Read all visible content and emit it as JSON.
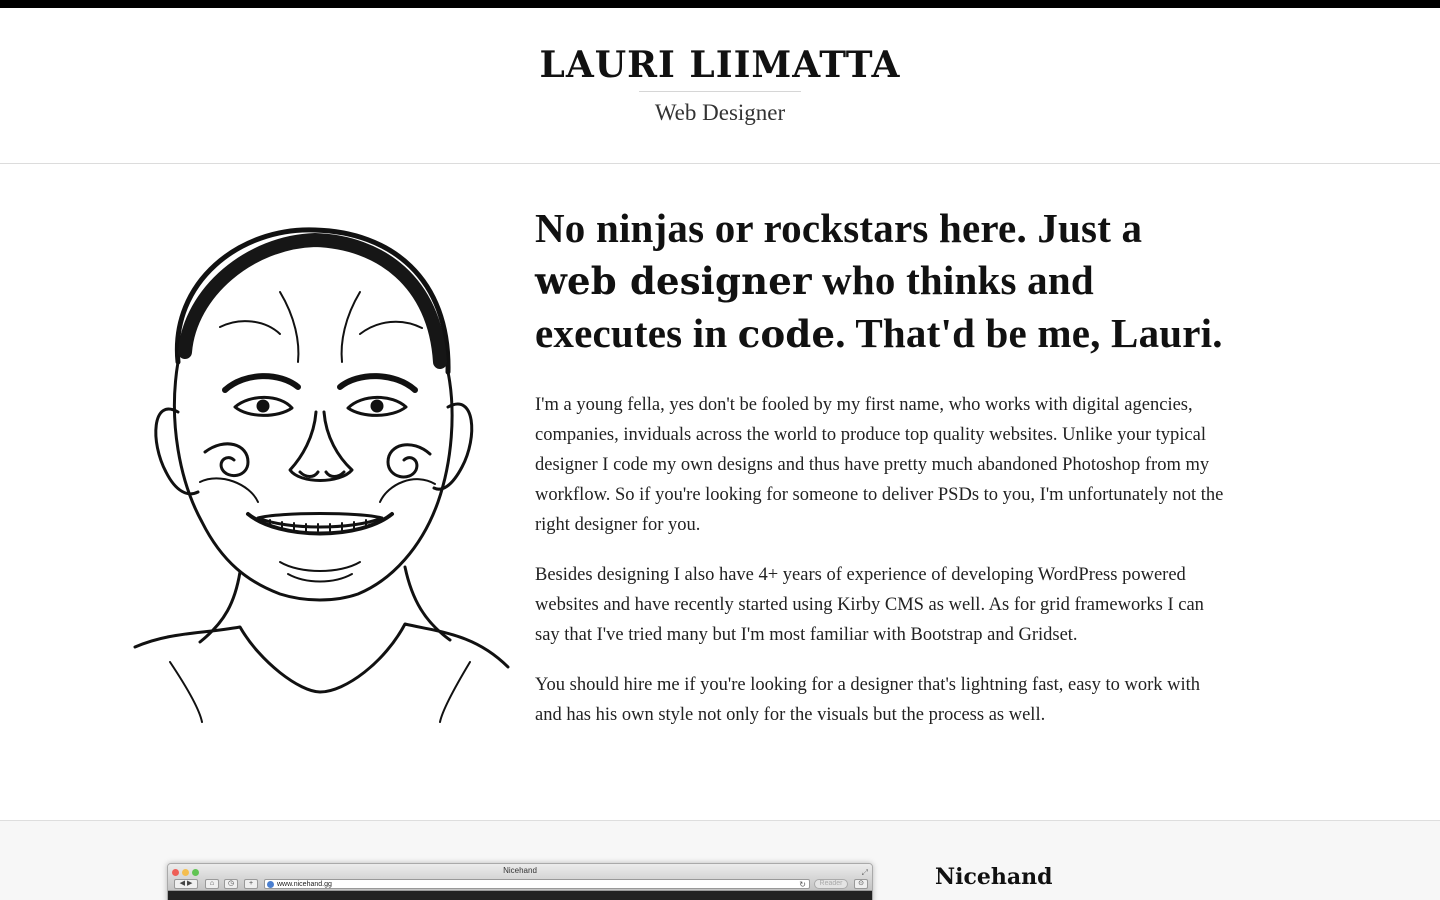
{
  "header": {
    "name": "LAURI LIIMATTA",
    "role": "Web Designer"
  },
  "portrait": {
    "icon": "portrait-illustration"
  },
  "intro": {
    "lead": {
      "part1": "No ninjas or rockstars here. Just a ",
      "bold1": "web designer",
      "part2": " who thinks and executes in ",
      "bold2": "code",
      "part3": ". That'd be me, Lauri."
    },
    "paragraphs": [
      "I'm a young fella, yes don't be fooled by my first name, who works with digital agencies, companies, inviduals across the world to produce top quality websites. Unlike your typical designer I code my own designs and thus have pretty much abandoned Photoshop from my workflow. So if you're looking for someone to deliver PSDs to you, I'm unfortunately not the right designer for you.",
      "Besides designing I also have 4+ years of experience of developing WordPress powered websites and have recently started using Kirby CMS as well. As for grid frameworks I can say that I've tried many but I'm most familiar with Bootstrap and Gridset.",
      "You should hire me if you're looking for a designer that's lightning fast, easy to work with and has his own style not only for the visuals but the process as well."
    ]
  },
  "work": {
    "browser": {
      "window_title": "Nicehand",
      "url": "www.nicehand.gg",
      "reader_label": "Reader"
    },
    "project_title": "Nicehand"
  }
}
